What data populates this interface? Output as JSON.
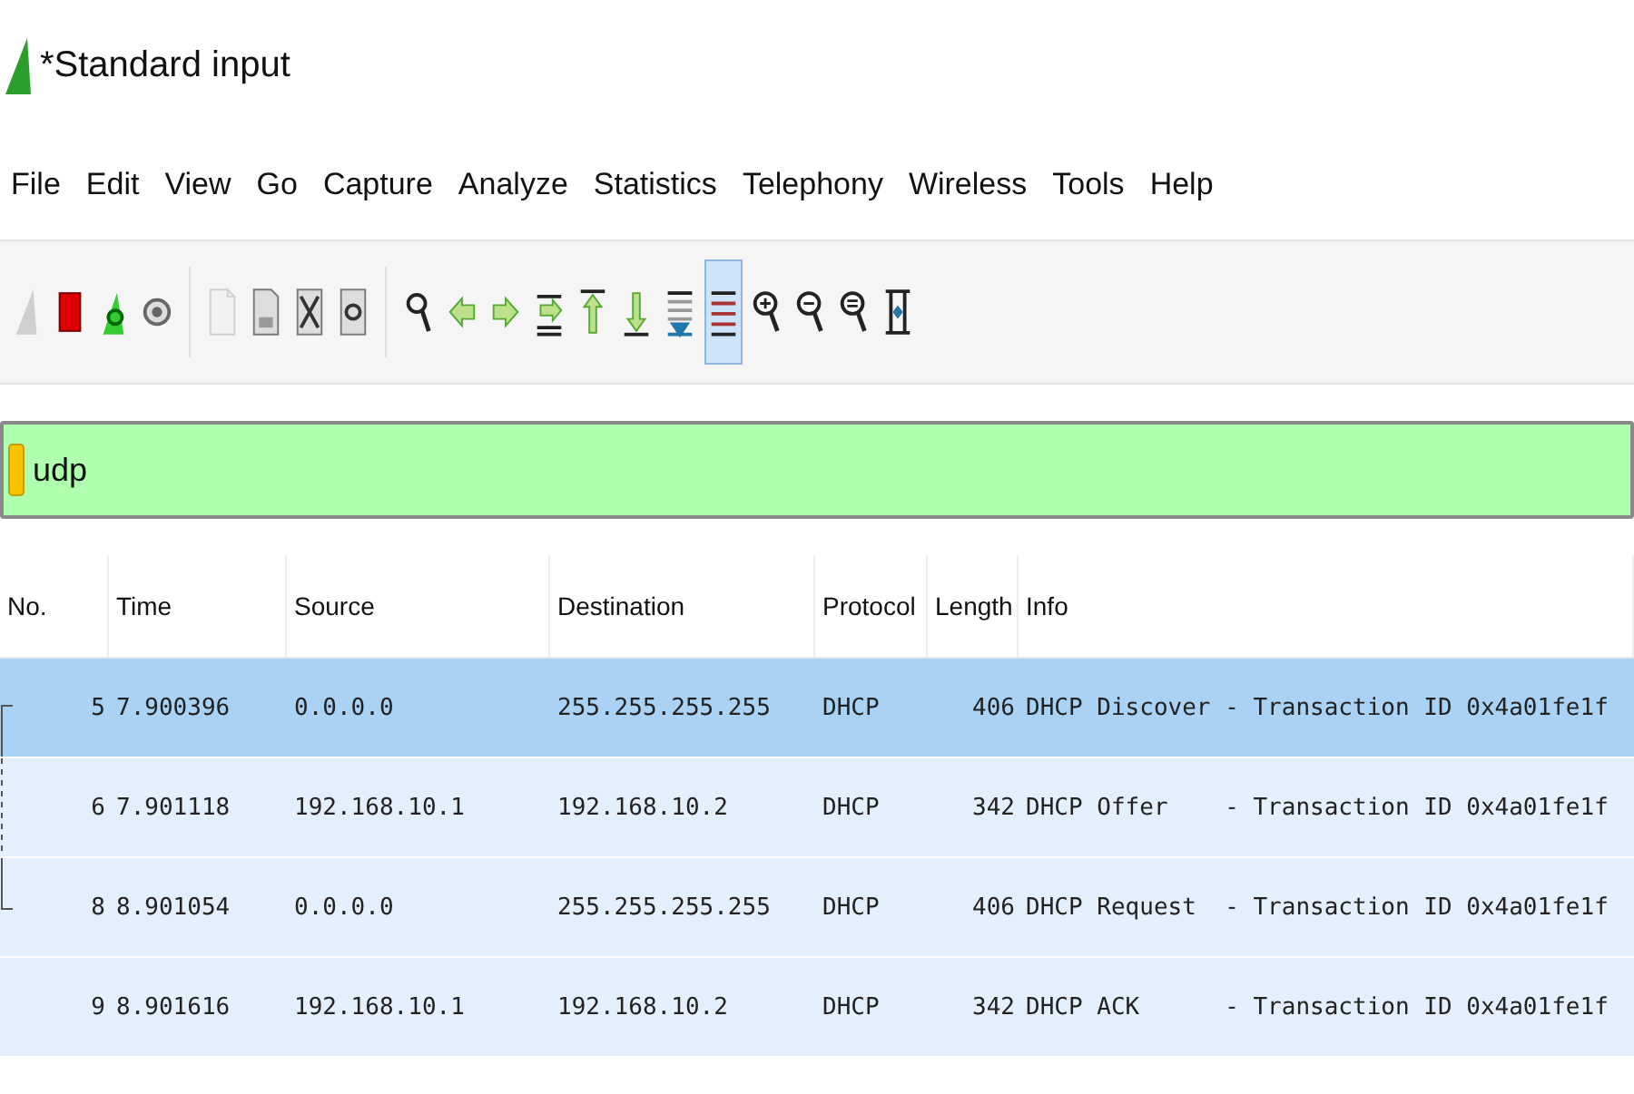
{
  "window": {
    "title": "*Standard input"
  },
  "menu": [
    "File",
    "Edit",
    "View",
    "Go",
    "Capture",
    "Analyze",
    "Statistics",
    "Telephony",
    "Wireless",
    "Tools",
    "Help"
  ],
  "toolbar": [
    {
      "kind": "start",
      "disabled": true,
      "on": false
    },
    {
      "kind": "stop",
      "disabled": false,
      "on": false
    },
    {
      "kind": "restart",
      "disabled": false,
      "on": false
    },
    {
      "kind": "options",
      "disabled": false,
      "on": false
    },
    {
      "kind": "open",
      "disabled": true,
      "on": false
    },
    {
      "kind": "save",
      "disabled": false,
      "on": false
    },
    {
      "kind": "close",
      "disabled": false,
      "on": false
    },
    {
      "kind": "reload",
      "disabled": false,
      "on": false
    },
    {
      "kind": "find",
      "disabled": false,
      "on": false
    },
    {
      "kind": "back",
      "disabled": false,
      "on": false
    },
    {
      "kind": "forward",
      "disabled": false,
      "on": false
    },
    {
      "kind": "goto",
      "disabled": false,
      "on": false
    },
    {
      "kind": "first",
      "disabled": false,
      "on": false
    },
    {
      "kind": "last",
      "disabled": false,
      "on": false
    },
    {
      "kind": "autoscroll",
      "disabled": false,
      "on": false
    },
    {
      "kind": "colorize",
      "disabled": false,
      "on": true
    },
    {
      "kind": "zoomin",
      "disabled": false,
      "on": false
    },
    {
      "kind": "zoomout",
      "disabled": false,
      "on": false
    },
    {
      "kind": "zoomreset",
      "disabled": false,
      "on": false
    },
    {
      "kind": "resize",
      "disabled": false,
      "on": false
    }
  ],
  "filter": {
    "value": "udp",
    "valid": true
  },
  "table": {
    "columns": [
      "No.",
      "Time",
      "Source",
      "Destination",
      "Protocol",
      "Length",
      "Info"
    ],
    "rows": [
      {
        "no": "5",
        "time": "7.900396",
        "source": "0.0.0.0",
        "destination": "255.255.255.255",
        "protocol": "DHCP",
        "length": "406",
        "info": "DHCP Discover - Transaction ID 0x4a01fe1f",
        "selected": true,
        "kind": "first"
      },
      {
        "no": "6",
        "time": "7.901118",
        "source": "192.168.10.1",
        "destination": "192.168.10.2",
        "protocol": "DHCP",
        "length": "342",
        "info": "DHCP Offer    - Transaction ID 0x4a01fe1f",
        "selected": false,
        "kind": "middle"
      },
      {
        "no": "8",
        "time": "8.901054",
        "source": "0.0.0.0",
        "destination": "255.255.255.255",
        "protocol": "DHCP",
        "length": "406",
        "info": "DHCP Request  - Transaction ID 0x4a01fe1f",
        "selected": false,
        "kind": "last"
      },
      {
        "no": "9",
        "time": "8.901616",
        "source": "192.168.10.1",
        "destination": "192.168.10.2",
        "protocol": "DHCP",
        "length": "342",
        "info": "DHCP ACK      - Transaction ID 0x4a01fe1f",
        "selected": false,
        "kind": "plain"
      }
    ]
  }
}
